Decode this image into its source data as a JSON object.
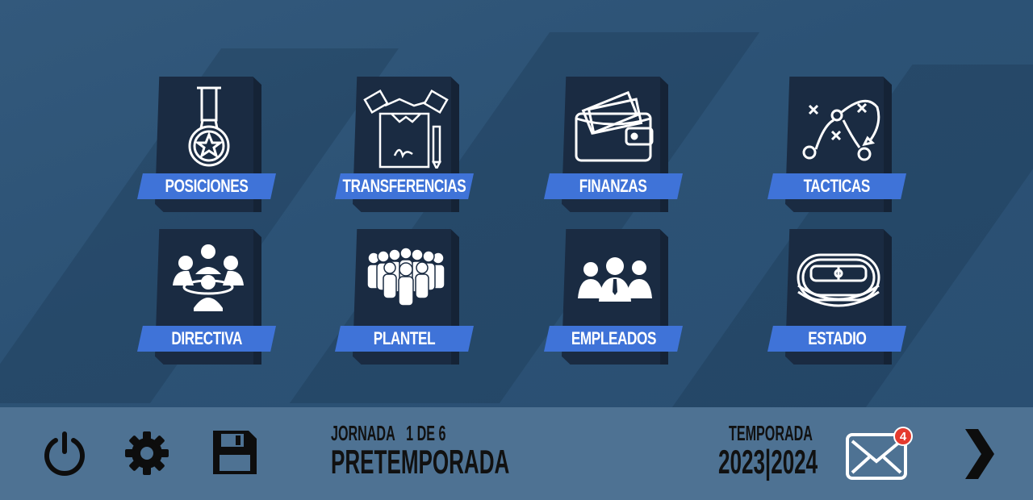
{
  "menu": {
    "items": [
      {
        "id": "posiciones",
        "label": "POSICIONES",
        "icon": "medal-icon"
      },
      {
        "id": "transferencias",
        "label": "TRANSFERENCIAS",
        "icon": "handshake-contract-icon"
      },
      {
        "id": "finanzas",
        "label": "FINANZAS",
        "icon": "wallet-icon"
      },
      {
        "id": "tacticas",
        "label": "TACTICAS",
        "icon": "tactics-board-icon"
      },
      {
        "id": "directiva",
        "label": "DIRECTIVA",
        "icon": "board-meeting-icon"
      },
      {
        "id": "plantel",
        "label": "PLANTEL",
        "icon": "squad-icon"
      },
      {
        "id": "empleados",
        "label": "EMPLEADOS",
        "icon": "employees-icon"
      },
      {
        "id": "estadio",
        "label": "ESTADIO",
        "icon": "stadium-icon"
      }
    ]
  },
  "status": {
    "jornada_label": "JORNADA",
    "jornada_value": "1 DE 6",
    "phase": "PRETEMPORADA",
    "season_label": "TEMPORADA",
    "season_value": "2023|2024"
  },
  "toolbar": {
    "power_icon": "power-icon",
    "settings_icon": "gear-icon",
    "save_icon": "floppy-disk-icon",
    "mail_icon": "envelope-icon",
    "next_icon": "chevron-right-icon",
    "unread_count": "4"
  },
  "colors": {
    "background": "#2c5275",
    "tile": "#1a2b42",
    "label_bar": "#3f73d8",
    "bottom_bar": "#4e7293",
    "badge": "#e53b2f"
  }
}
